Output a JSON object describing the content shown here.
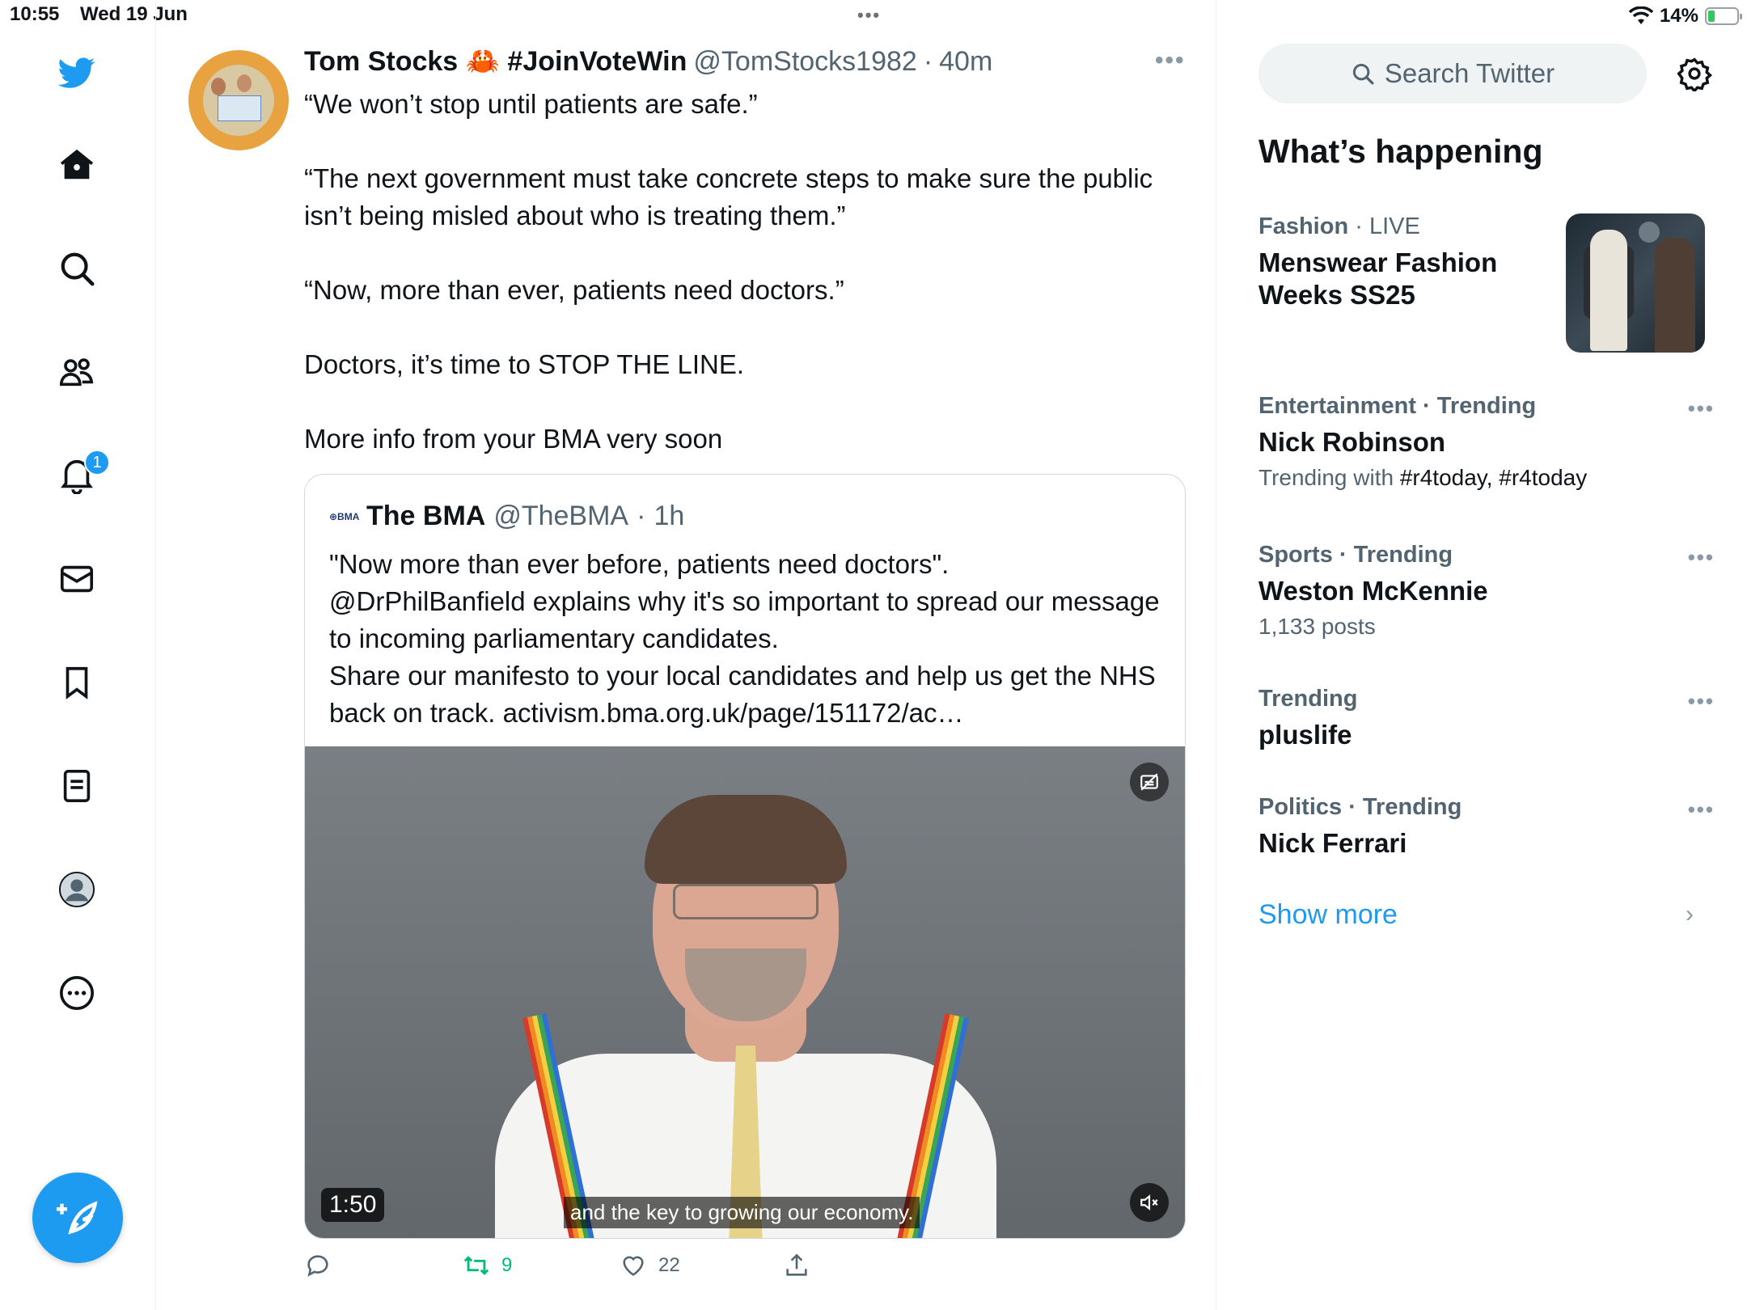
{
  "status_bar": {
    "time": "10:55",
    "date": "Wed 19 Jun",
    "battery": "14%"
  },
  "nav": {
    "notification_count": "1",
    "icons": [
      "twitter-logo-icon",
      "home-icon",
      "explore-icon",
      "communities-icon",
      "notifications-icon",
      "messages-icon",
      "bookmarks-icon",
      "lists-icon",
      "profile-icon",
      "more-icon",
      "compose-icon"
    ]
  },
  "tweet": {
    "author_name": "Tom Stocks 🦀 #JoinVoteWin",
    "author_handle": "@TomStocks1982",
    "separator": "·",
    "time": "40m",
    "lines": [
      "“We won’t stop until patients are safe.”",
      "“The next government must take concrete steps to make sure the public isn’t being misled about who is treating them.”",
      "“Now, more than ever, patients need doctors.”",
      "Doctors, it’s time to STOP THE LINE.",
      "More info from your BMA very soon"
    ],
    "actions": {
      "retweets": "9",
      "likes": "22"
    }
  },
  "quote": {
    "logo_text": "⊕BMA",
    "author_name": "The BMA",
    "author_handle": "@TheBMA",
    "separator": "·",
    "time": "1h",
    "lines": [
      "\"Now more than ever before, patients need doctors\".",
      "@DrPhilBanfield explains why it's so important to spread our message to incoming parliamentary candidates.",
      "Share our manifesto to your local candidates and help us get the NHS back on track. activism.bma.org.uk/page/151172/ac…"
    ],
    "video": {
      "duration": "1:50",
      "caption": "and the key to growing our economy."
    }
  },
  "sidebar": {
    "search_placeholder": "Search Twitter",
    "title": "What’s happening",
    "trends": [
      {
        "category": "Fashion",
        "status": "LIVE",
        "title": "Menswear Fashion Weeks SS25"
      },
      {
        "category": "Entertainment · Trending",
        "title": "Nick Robinson",
        "sub_prefix": "Trending with ",
        "sub_tags": "#r4today, #r4today"
      },
      {
        "category": "Sports · Trending",
        "title": "Weston McKennie",
        "sub": "1,133 posts"
      },
      {
        "category": "Trending",
        "title": "pluslife"
      },
      {
        "category": "Politics · Trending",
        "title": "Nick Ferrari"
      }
    ],
    "show_more": "Show more"
  },
  "colors": {
    "accent": "#1d9bf0",
    "retweet_green": "#00ba7c",
    "secondary_text": "#536471"
  }
}
